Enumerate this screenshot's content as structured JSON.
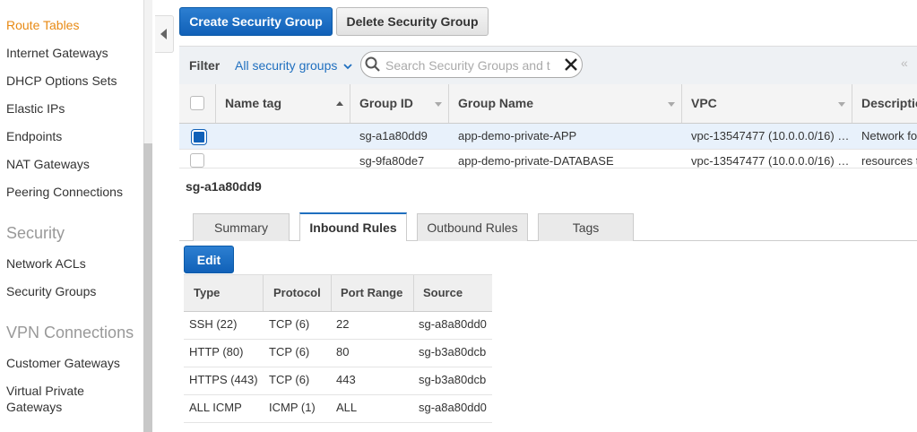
{
  "sidebar": {
    "items": [
      {
        "label": "Route Tables"
      },
      {
        "label": "Internet Gateways"
      },
      {
        "label": "DHCP Options Sets"
      },
      {
        "label": "Elastic IPs"
      },
      {
        "label": "Endpoints"
      },
      {
        "label": "NAT Gateways"
      },
      {
        "label": "Peering Connections"
      }
    ],
    "security_section": "Security",
    "security_items": [
      {
        "label": "Network ACLs"
      },
      {
        "label": "Security Groups"
      }
    ],
    "vpn_section": "VPN Connections",
    "vpn_items": [
      {
        "label": "Customer Gateways"
      },
      {
        "label": "Virtual Private"
      },
      {
        "label": "Gateways"
      }
    ]
  },
  "toolbar": {
    "create_label": "Create Security Group",
    "delete_label": "Delete Security Group"
  },
  "filter": {
    "label": "Filter",
    "select_value": "All security groups",
    "search_placeholder": "Search Security Groups and t"
  },
  "table": {
    "columns": [
      "Name tag",
      "Group ID",
      "Group Name",
      "VPC",
      "Descriptio"
    ],
    "rows": [
      {
        "name_tag": "",
        "group_id": "sg-a1a80dd9",
        "group_name": "app-demo-private-APP",
        "vpc": "vpc-13547477 (10.0.0.0/16) …",
        "description": "Network fo"
      },
      {
        "name_tag": "",
        "group_id": "sg-9fa80de7",
        "group_name": "app-demo-private-DATABASE",
        "vpc": "vpc-13547477 (10.0.0.0/16) …",
        "description": "resources t"
      }
    ]
  },
  "detail": {
    "title": "sg-a1a80dd9",
    "tabs": [
      "Summary",
      "Inbound Rules",
      "Outbound Rules",
      "Tags"
    ],
    "edit_label": "Edit",
    "rules_columns": [
      "Type",
      "Protocol",
      "Port Range",
      "Source"
    ],
    "rules": [
      {
        "type": "SSH (22)",
        "protocol": "TCP (6)",
        "port": "22",
        "source": "sg-a8a80dd0"
      },
      {
        "type": "HTTP (80)",
        "protocol": "TCP (6)",
        "port": "80",
        "source": "sg-b3a80dcb"
      },
      {
        "type": "HTTPS (443)",
        "protocol": "TCP (6)",
        "port": "443",
        "source": "sg-b3a80dcb"
      },
      {
        "type": "ALL ICMP",
        "protocol": "ICMP (1)",
        "port": "ALL",
        "source": "sg-a8a80dd0"
      }
    ]
  },
  "colors": {
    "accent": "#1161b8",
    "active_nav": "#e88a14"
  }
}
